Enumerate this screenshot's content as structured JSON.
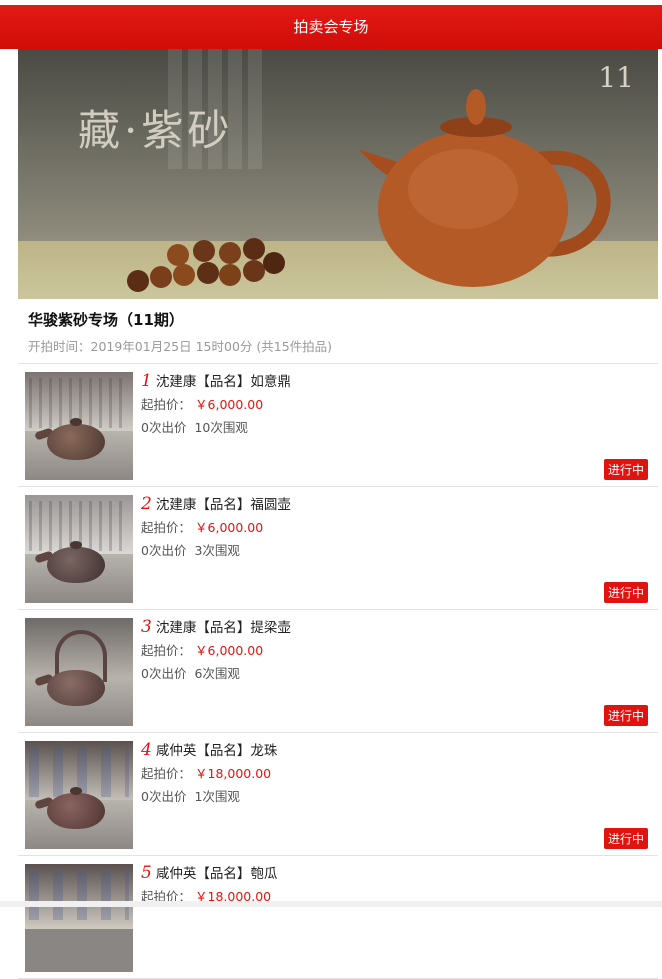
{
  "header": {
    "title": "拍卖会专场"
  },
  "banner": {
    "title": "藏·紫砂",
    "issue": "11"
  },
  "session": {
    "name": "华骏紫砂专场（11期）",
    "time_line": "开拍时间：2019年01月25日 15时00分 (共15件拍品)"
  },
  "labels": {
    "start_price": "起拍价："
  },
  "items": [
    {
      "no": "1",
      "title": "沈建康【品名】如意鼎",
      "price": "￥6,000.00",
      "bids": "0次出价",
      "views": "10次围观",
      "status": "进行中"
    },
    {
      "no": "2",
      "title": "沈建康【品名】福圆壶",
      "price": "￥6,000.00",
      "bids": "0次出价",
      "views": "3次围观",
      "status": "进行中"
    },
    {
      "no": "3",
      "title": "沈建康【品名】提梁壶",
      "price": "￥6,000.00",
      "bids": "0次出价",
      "views": "6次围观",
      "status": "进行中"
    },
    {
      "no": "4",
      "title": "咸仲英【品名】龙珠",
      "price": "￥18,000.00",
      "bids": "0次出价",
      "views": "1次围观",
      "status": "进行中"
    },
    {
      "no": "5",
      "title": "咸仲英【品名】匏瓜",
      "price": "￥18,000.00"
    }
  ],
  "colors": {
    "accent": "#e0140f",
    "header": "#d8120e"
  }
}
